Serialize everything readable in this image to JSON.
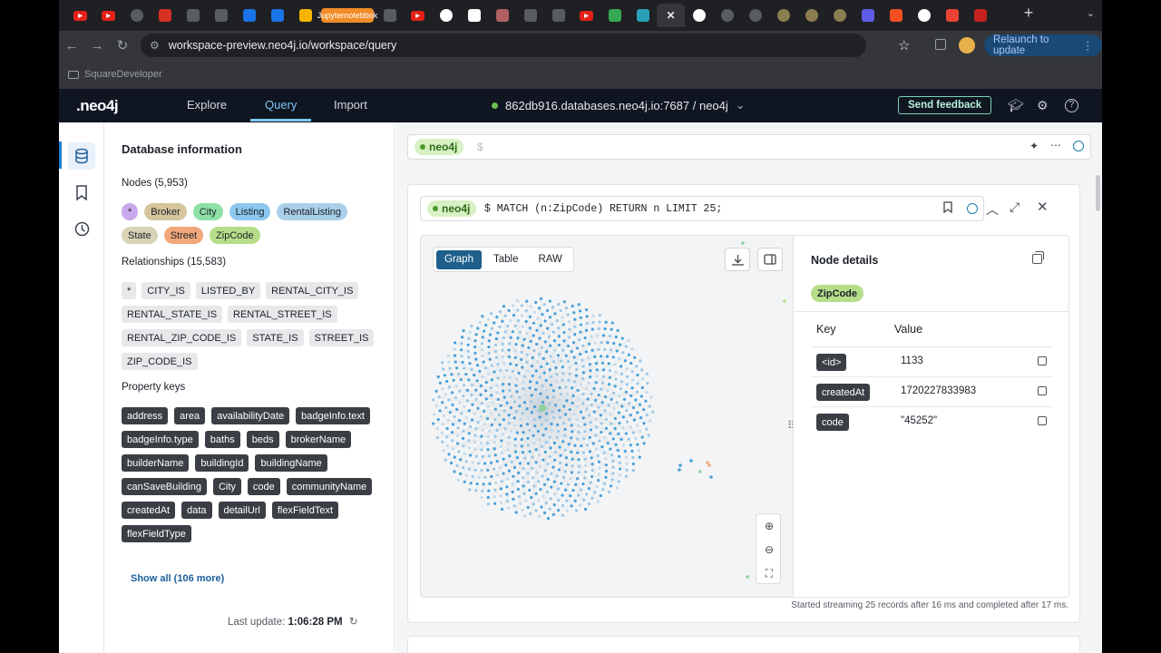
{
  "browser": {
    "url": "workspace-preview.neo4j.io/workspace/query",
    "named_tab": "Jupyternotebbok",
    "relaunch_label": "Relaunch to update",
    "bookmark_folder": "SquareDeveloper",
    "tab_favicons": [
      {
        "icon": "youtube-icon",
        "color": "#e62117"
      },
      {
        "icon": "youtube-icon",
        "color": "#e62117"
      },
      {
        "icon": "openai-icon",
        "color": "#5f6368"
      },
      {
        "icon": "record-icon",
        "color": "#d93025"
      },
      {
        "icon": "github-copilot-icon",
        "color": "#5f6368"
      },
      {
        "icon": "app-icon",
        "color": "#5f6368"
      },
      {
        "icon": "azure-icon",
        "color": "#1a73e8"
      },
      {
        "icon": "azure-icon",
        "color": "#1a73e8"
      },
      {
        "icon": "hand-icon",
        "color": "#f6b400"
      },
      {
        "icon": "chatgpt-icon",
        "color": "#5f6368"
      },
      {
        "icon": "youtube-icon",
        "color": "#e62117"
      },
      {
        "icon": "github-icon",
        "color": "#ffffff"
      },
      {
        "icon": "tv-icon",
        "color": "#ffffff"
      },
      {
        "icon": "record-icon",
        "color": "#b06060"
      },
      {
        "icon": "arrow-icon",
        "color": "#5f6368"
      },
      {
        "icon": "arrow-icon",
        "color": "#5f6368"
      },
      {
        "icon": "youtube-icon",
        "color": "#e62117"
      },
      {
        "icon": "bolt-icon",
        "color": "#34a853"
      },
      {
        "icon": "neo4j-icon",
        "color": "#2aa0b8"
      },
      {
        "icon": "close-icon",
        "color": "#e8eaed"
      },
      {
        "icon": "google-icon",
        "color": "#ffffff"
      },
      {
        "icon": "openai-icon",
        "color": "#5f6368"
      },
      {
        "icon": "openai-icon",
        "color": "#5f6368"
      },
      {
        "icon": "globe-icon",
        "color": "#8a7d4f"
      },
      {
        "icon": "globe-icon",
        "color": "#8a7d4f"
      },
      {
        "icon": "globe-icon",
        "color": "#8a7d4f"
      },
      {
        "icon": "play-icon",
        "color": "#5e5ce6"
      },
      {
        "icon": "microsoft-icon",
        "color": "#f25022"
      },
      {
        "icon": "google-icon",
        "color": "#ffffff"
      },
      {
        "icon": "gmail-icon",
        "color": "#ea4335"
      },
      {
        "icon": "gmail-icon",
        "color": "#c5221f"
      }
    ]
  },
  "app": {
    "logo": ".neo4j",
    "nav": [
      "Explore",
      "Query",
      "Import"
    ],
    "connection": "862db916.databases.neo4j.io:7687 / neo4j",
    "feedback_label": "Send feedback"
  },
  "dbinfo": {
    "title": "Database information",
    "nodes_heading": "Nodes (5,953)",
    "node_labels": [
      {
        "text": "*",
        "color": "#c9a9ec"
      },
      {
        "text": "Broker",
        "color": "#d4c59c"
      },
      {
        "text": "City",
        "color": "#8fe0a6"
      },
      {
        "text": "Listing",
        "color": "#8cc7ee"
      },
      {
        "text": "RentalListing",
        "color": "#a9cfe9"
      },
      {
        "text": "State",
        "color": "#d9d3b6"
      },
      {
        "text": "Street",
        "color": "#f0a87a"
      },
      {
        "text": "ZipCode",
        "color": "#b6de8a"
      }
    ],
    "relationships_heading": "Relationships (15,583)",
    "relationships": [
      "*",
      "CITY_IS",
      "LISTED_BY",
      "RENTAL_CITY_IS",
      "RENTAL_STATE_IS",
      "RENTAL_STREET_IS",
      "RENTAL_ZIP_CODE_IS",
      "STATE_IS",
      "STREET_IS",
      "ZIP_CODE_IS"
    ],
    "property_heading": "Property keys",
    "property_keys": [
      "address",
      "area",
      "availabilityDate",
      "badgeInfo.text",
      "badgeInfo.type",
      "baths",
      "beds",
      "brokerName",
      "builderName",
      "buildingId",
      "buildingName",
      "canSaveBuilding",
      "City",
      "code",
      "communityName",
      "createdAt",
      "data",
      "detailUrl",
      "flexFieldText",
      "flexFieldType"
    ],
    "show_all": "Show all (106 more)",
    "last_update_label": "Last update:",
    "last_update_time": "1:06:28 PM"
  },
  "editor": {
    "db": "neo4j",
    "prompt": "$"
  },
  "result": {
    "db": "neo4j",
    "query": "$ MATCH (n:ZipCode) RETURN n LIMIT 25;",
    "view_tabs": [
      "Graph",
      "Table",
      "RAW"
    ],
    "active_view": "Graph",
    "details_title": "Node details",
    "label": "ZipCode",
    "col_key": "Key",
    "col_value": "Value",
    "properties": [
      {
        "key": "<id>",
        "value": "1133"
      },
      {
        "key": "createdAt",
        "value": "1720227833983"
      },
      {
        "key": "code",
        "value": "\"45252\""
      }
    ],
    "status": "Started streaming 25 records after 16 ms and completed after 17 ms."
  }
}
